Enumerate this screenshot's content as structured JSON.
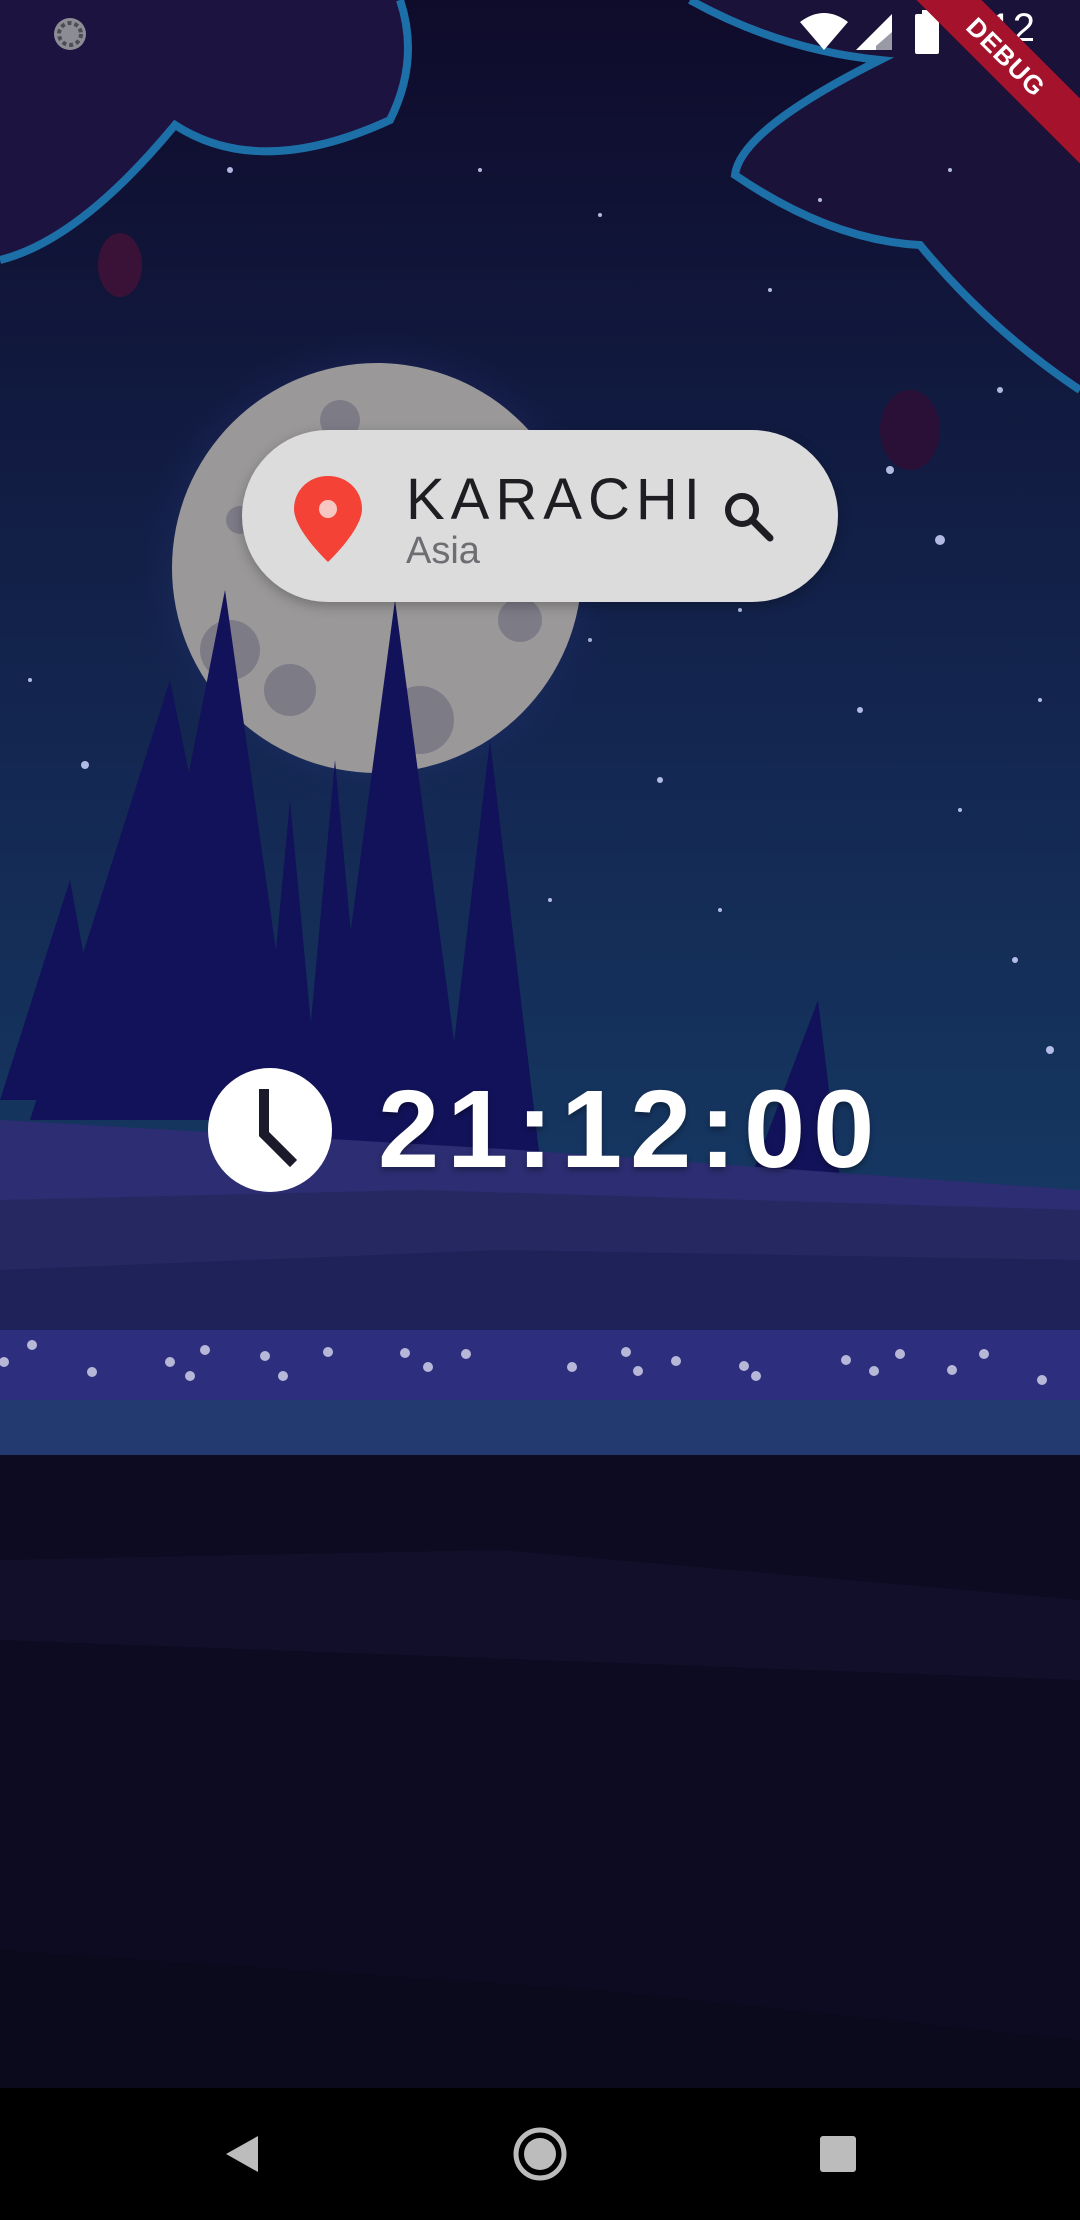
{
  "status_bar": {
    "time": "4:12"
  },
  "debug_banner": {
    "label": "DEBUG"
  },
  "location": {
    "city": "KARACHI",
    "region": "Asia"
  },
  "clock": {
    "time": "21:12:00"
  },
  "icons": {
    "status_left": "settings-sync-icon",
    "wifi": "wifi-icon",
    "signal": "cell-signal-icon",
    "battery": "battery-icon",
    "pin": "location-pin-icon",
    "search": "search-icon",
    "clock": "clock-icon",
    "nav_back": "back-icon",
    "nav_home": "home-icon",
    "nav_recents": "recents-icon"
  },
  "colors": {
    "pin": "#f44336",
    "pill_background": "#dcdcdd",
    "sky_top": "#0f0b2b",
    "sky_bottom": "#14335a",
    "ground": "#0d0b22",
    "debug": "#a4122c"
  }
}
